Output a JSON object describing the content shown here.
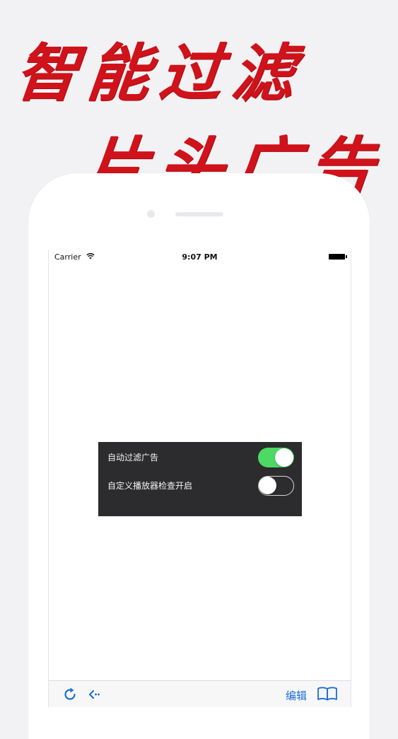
{
  "promo": {
    "headline_line1": "智能过滤",
    "headline_line2": "片头广告",
    "headline_color": "#d0121b"
  },
  "status_bar": {
    "carrier": "Carrier",
    "time": "9:07 PM",
    "icons": [
      "wifi-icon",
      "battery-icon"
    ]
  },
  "settings": {
    "items": [
      {
        "label": "自动过滤广告",
        "enabled": true
      },
      {
        "label": "自定义播放器检查开启",
        "enabled": false
      }
    ],
    "toggle_on_color": "#4cd964",
    "panel_color": "#2c2c2e"
  },
  "toolbar": {
    "edit_label": "编辑",
    "icons": [
      "reload-icon",
      "back-icon",
      "bookmarks-icon"
    ],
    "accent_color": "#1a6fd6"
  }
}
